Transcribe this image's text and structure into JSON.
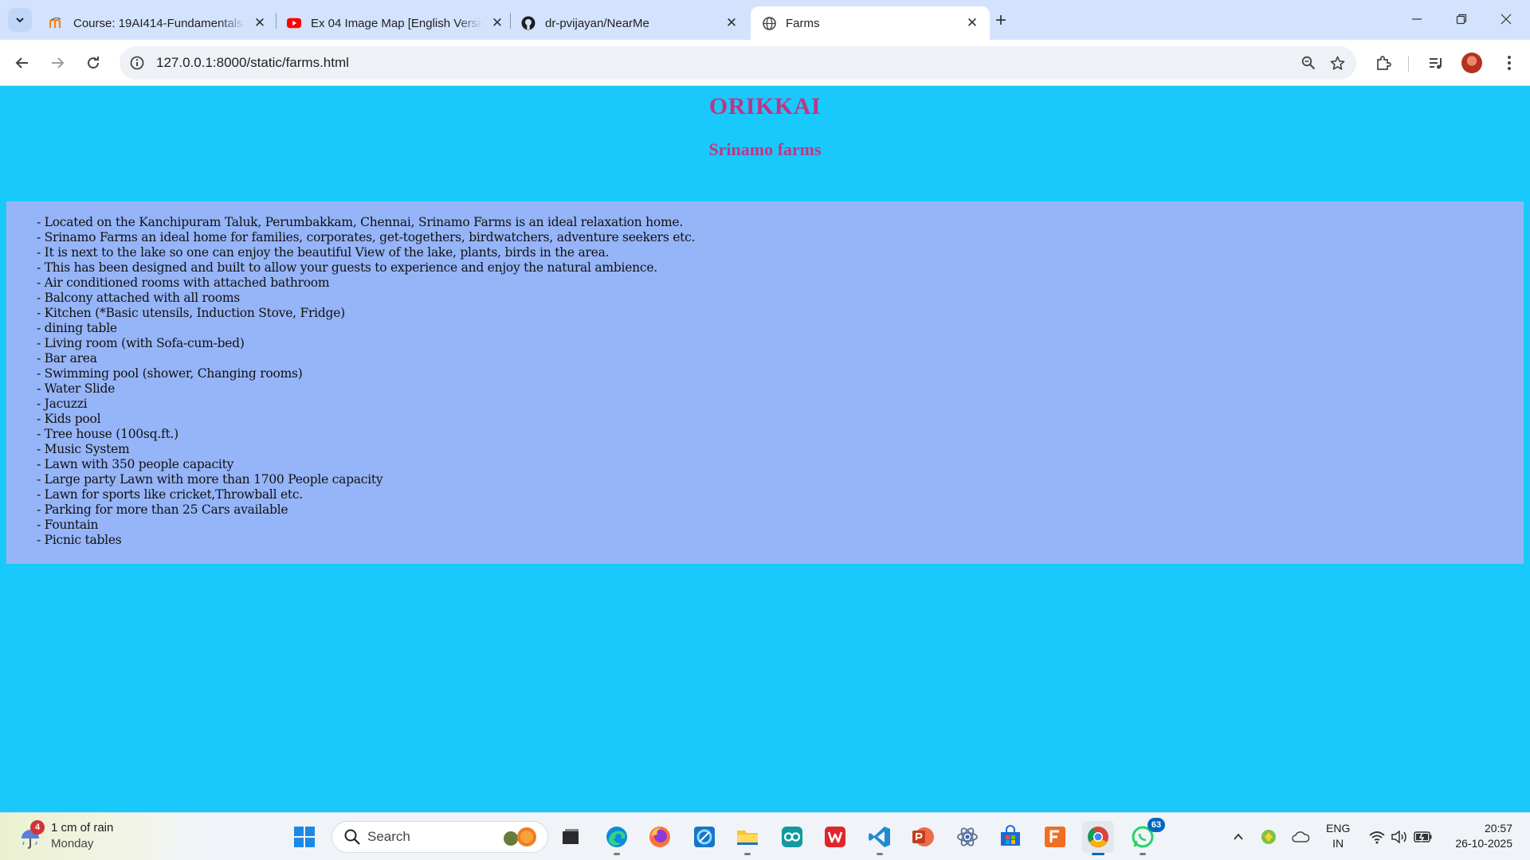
{
  "browser": {
    "tabs": [
      {
        "title": "Course: 19AI414-Fundamentals",
        "favicon": "moodle-icon",
        "active": false
      },
      {
        "title": "Ex 04 Image Map [English Version]",
        "favicon": "youtube-icon",
        "active": false
      },
      {
        "title": "dr-pvijayan/NearMe",
        "favicon": "github-icon",
        "active": false
      },
      {
        "title": "Farms",
        "favicon": "globe-icon",
        "active": true
      }
    ],
    "url": "127.0.0.1:8000/static/farms.html"
  },
  "page": {
    "heading": "ORIKKAI",
    "subheading": "Srinamo farms",
    "features": [
      "- Located on the Kanchipuram Taluk, Perumbakkam, Chennai, Srinamo Farms  is an ideal relaxation home.",
      "- Srinamo Farms an ideal home for families, corporates, get-togethers, birdwatchers, adventure seekers etc.",
      "- It is next to the lake so one can enjoy the beautiful View of the lake, plants, birds in the area.",
      "- This has been designed and built to allow your guests to experience and enjoy the natural ambience.",
      "- Air conditioned rooms with attached bathroom",
      "- Balcony attached with all rooms",
      "- Kitchen (*Basic utensils, Induction Stove, Fridge)",
      "- dining table",
      "- Living room (with Sofa-cum-bed)",
      "- Bar area",
      "- Swimming pool (shower, Changing rooms)",
      "- Water Slide",
      "- Jacuzzi",
      "- Kids pool",
      "- Tree house (100sq.ft.)",
      "- Music System",
      "- Lawn with 350 people capacity",
      "- Large party Lawn with more than 1700 People capacity",
      "- Lawn for sports like cricket,Throwball etc.",
      "- Parking for more than 25 Cars available",
      "- Fountain",
      "- Picnic tables"
    ]
  },
  "taskbar": {
    "weather": {
      "badge": "4",
      "line1": "1 cm of rain",
      "line2": "Monday"
    },
    "search_label": "Search",
    "whatsapp_badge": "63",
    "lang_line1": "ENG",
    "lang_line2": "IN",
    "time": "20:57",
    "date": "26-10-2025"
  },
  "colors": {
    "page_bg": "#19c9fb",
    "box_bg": "#96b5f8",
    "heading": "#c13584"
  }
}
